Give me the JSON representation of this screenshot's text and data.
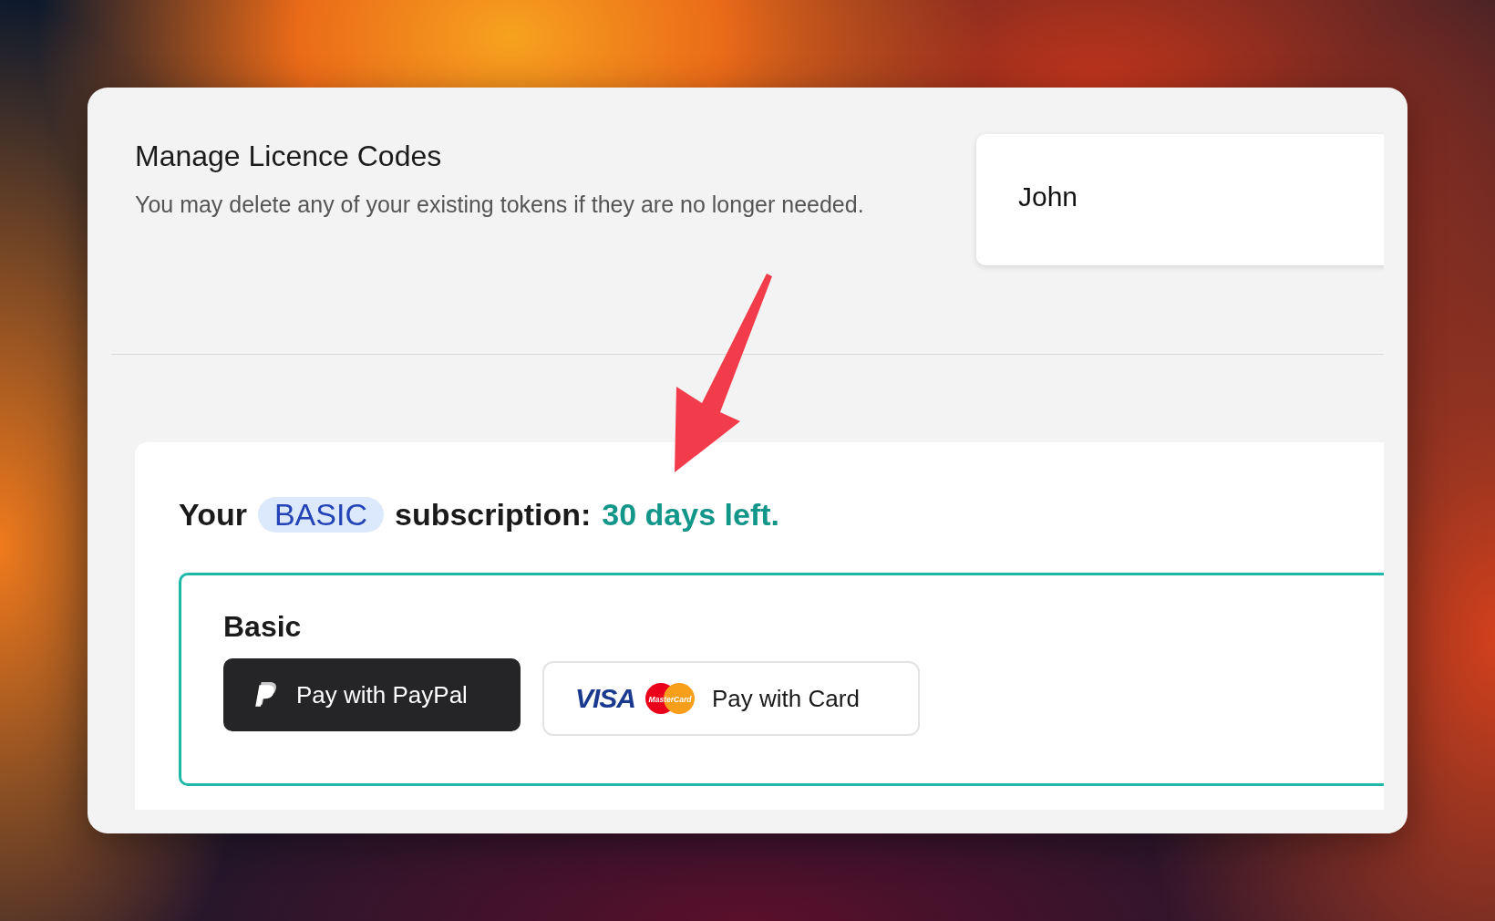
{
  "title": "Manage Licence Codes",
  "description": "You may delete any of your existing tokens if they are no longer needed.",
  "user_name": "John",
  "subscription": {
    "prefix": "Your",
    "plan_badge": "BASIC",
    "label": "subscription:",
    "remaining": "30 days left."
  },
  "plan": {
    "name": "Basic",
    "buttons": [
      {
        "kind": "paypal",
        "label": "Pay with PayPal"
      },
      {
        "kind": "card",
        "label": "Pay with Card",
        "logos": [
          "VISA",
          "MasterCard"
        ]
      }
    ]
  }
}
